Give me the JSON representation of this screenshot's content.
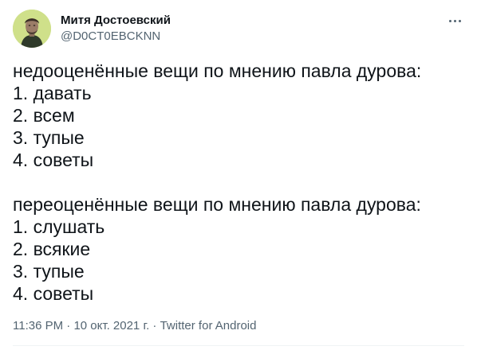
{
  "author": {
    "display_name": "Митя Достоевский",
    "handle": "@D0CT0EBCKNN",
    "avatar_icon": "portrait-avatar"
  },
  "header": {
    "more_icon": "more-dots-icon"
  },
  "tweet": {
    "blocks": [
      {
        "heading": "недооценённые вещи по мнению павла дурова:",
        "items": [
          "1. давать",
          "2. всем",
          "3. тупые",
          "4. советы"
        ]
      },
      {
        "heading": "переоценённые вещи по мнению павла дурова:",
        "items": [
          "1. слушать",
          "2. всякие",
          "3. тупые",
          "4. советы"
        ]
      }
    ]
  },
  "meta": {
    "time": "11:36 PM",
    "separator": "·",
    "date": "10 окт. 2021 г.",
    "source": "Twitter for Android"
  },
  "colors": {
    "text_primary": "#0f1419",
    "text_secondary": "#536471",
    "avatar_background": "#cfe08a",
    "divider": "#eff3f4"
  }
}
